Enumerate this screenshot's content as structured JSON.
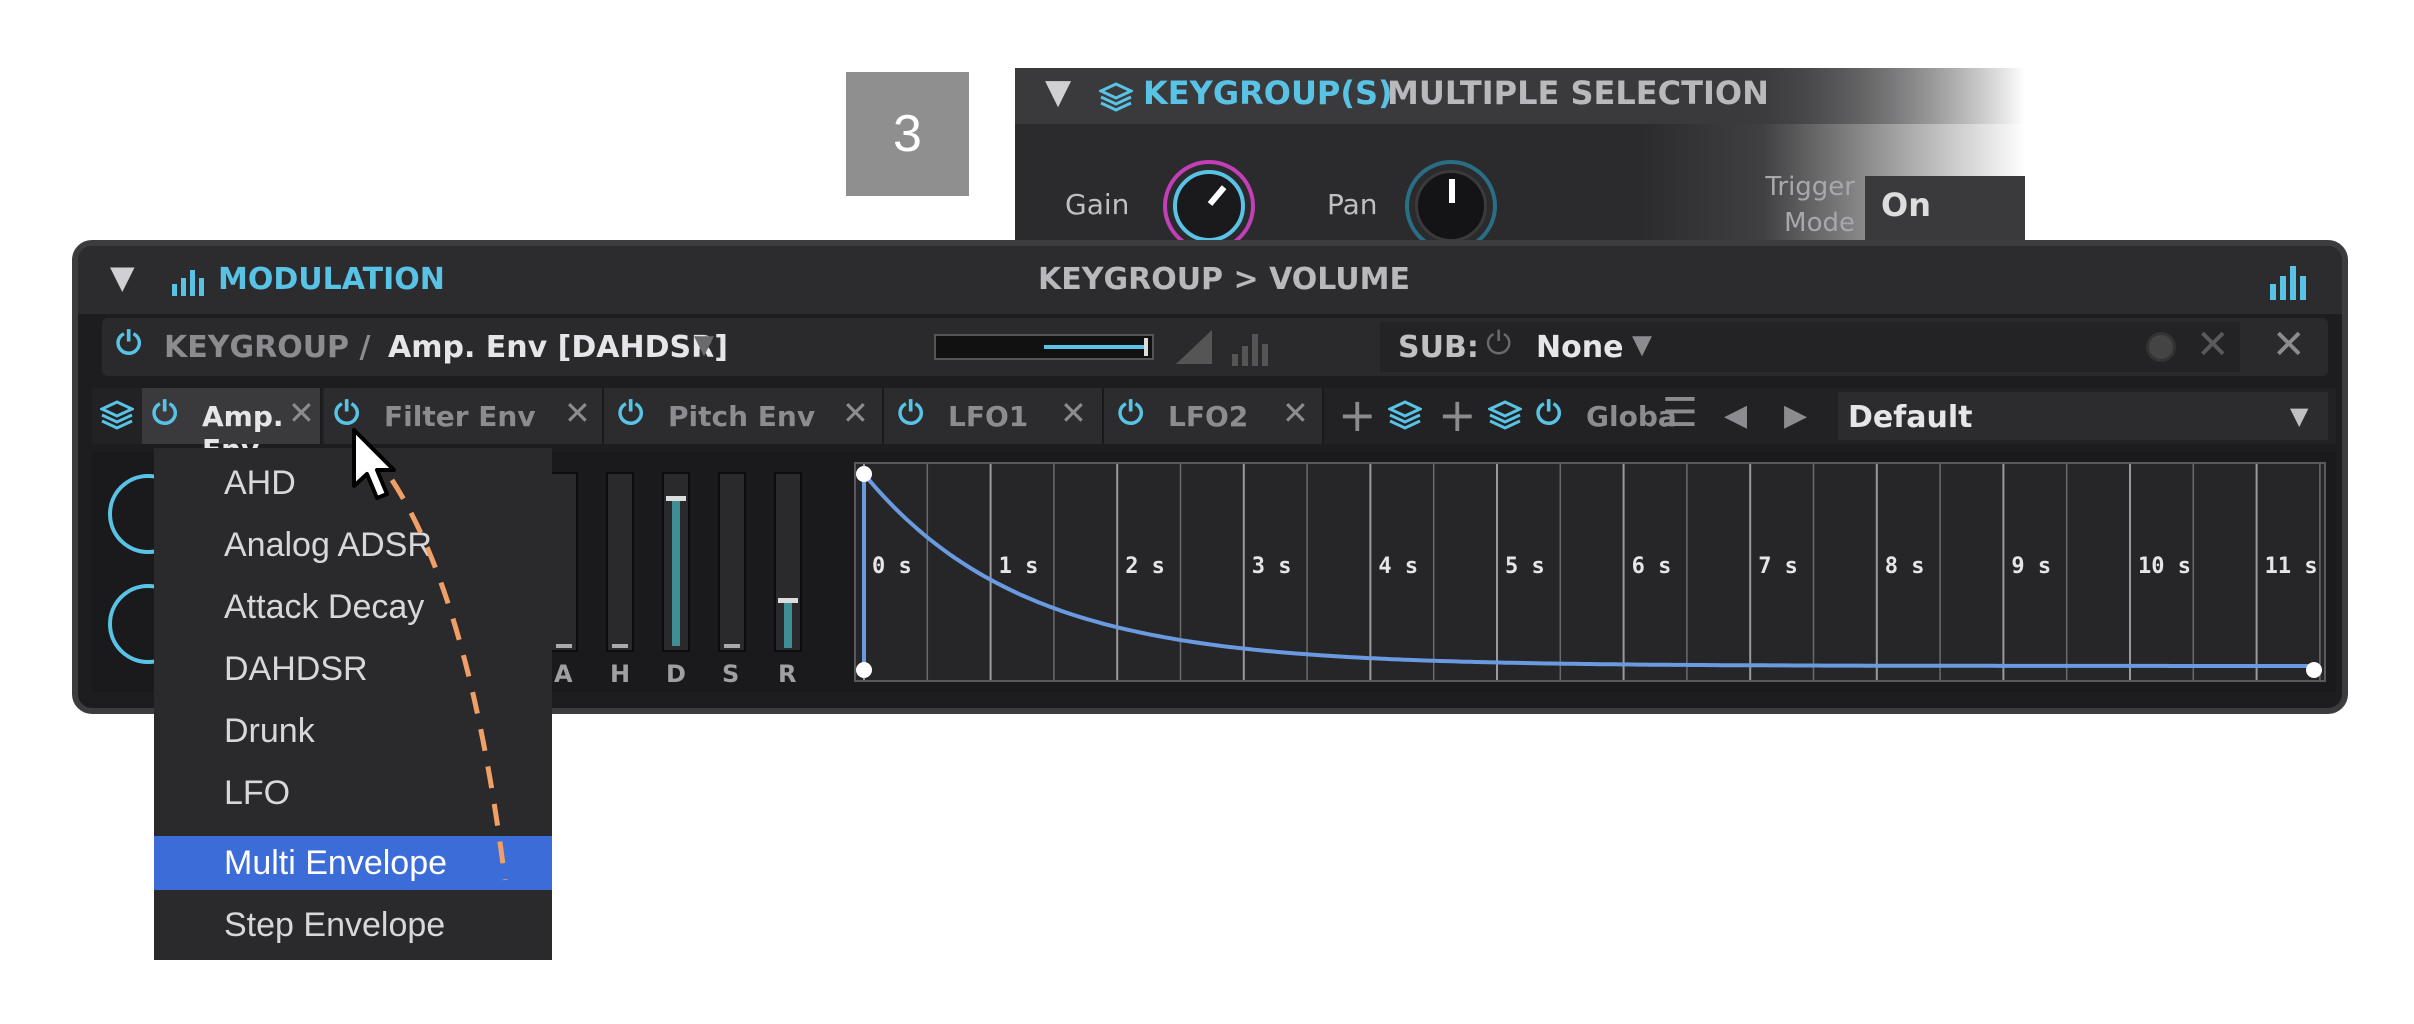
{
  "step_number": "3",
  "keygroup_panel": {
    "title": "KEYGROUP(S)",
    "subtitle": "MULTIPLE SELECTION",
    "gain_label": "Gain",
    "pan_label": "Pan",
    "trigger_label_line1": "Trigger",
    "trigger_label_line2": "Mode",
    "trigger_value": "On"
  },
  "modulation": {
    "title": "MODULATION",
    "target": "KEYGROUP > VOLUME",
    "path_prefix": "KEYGROUP /",
    "path_name": "Amp. Env [DAHDSR]",
    "sub_label": "SUB:",
    "sub_value": "None",
    "tabs": [
      {
        "label": "Amp. Env"
      },
      {
        "label": "Filter Env"
      },
      {
        "label": "Pitch Env"
      },
      {
        "label": "LFO1"
      },
      {
        "label": "LFO2"
      }
    ],
    "global_label": "Globa",
    "preset_value": "Default",
    "slider_labels": [
      "A",
      "H",
      "D",
      "S",
      "R"
    ],
    "time_labels": [
      "0 s",
      "1 s",
      "2 s",
      "3 s",
      "4 s",
      "5 s",
      "6 s",
      "7 s",
      "8 s",
      "9 s",
      "10 s",
      "11 s"
    ]
  },
  "menu": {
    "items": [
      "AHD",
      "Analog ADSR",
      "Attack Decay",
      "DAHDSR",
      "Drunk",
      "LFO",
      "Multi Envelope",
      "Step Envelope"
    ],
    "selected": "Multi Envelope"
  },
  "colors": {
    "accent": "#59c3e6",
    "selected_menu": "#3b6cd8",
    "curve": "#6a9be0",
    "gain_ring": "#c33fb8",
    "arrow": "#f0a066"
  }
}
